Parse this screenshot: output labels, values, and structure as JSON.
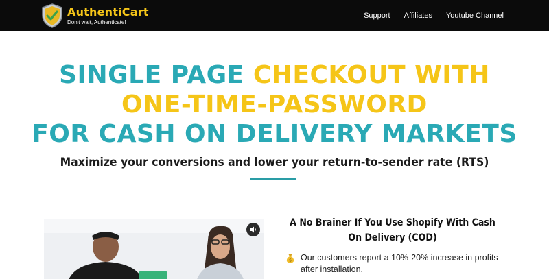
{
  "brand": {
    "name": "AuthentiCart",
    "tagline": "Don't wait, Authenticate!",
    "logo_icon": "shield-check-icon",
    "colors": {
      "accent_yellow": "#f5c518",
      "accent_teal": "#2aa9b5",
      "nav_bg": "#0b0b0b"
    }
  },
  "nav": {
    "links": [
      {
        "label": "Support"
      },
      {
        "label": "Affiliates"
      },
      {
        "label": "Youtube Channel"
      }
    ]
  },
  "hero": {
    "line1_teal": "SINGLE PAGE ",
    "line1_yellow": "CHECKOUT WITH",
    "line2_yellow": "ONE-TIME-PASSWORD",
    "line3_teal": "FOR CASH ON DELIVERY MARKETS",
    "subtitle": "Maximize your conversions and lower your return-to-sender rate (RTS)"
  },
  "video": {
    "volume_icon": "volume-icon",
    "play_icon": "play-icon"
  },
  "features": {
    "heading": "A No Brainer If You Use Shopify With Cash On Delivery (COD)",
    "items": [
      {
        "icon": "money-bag-icon",
        "text": "Our customers report a 10%-20% increase in profits after installation."
      }
    ]
  }
}
